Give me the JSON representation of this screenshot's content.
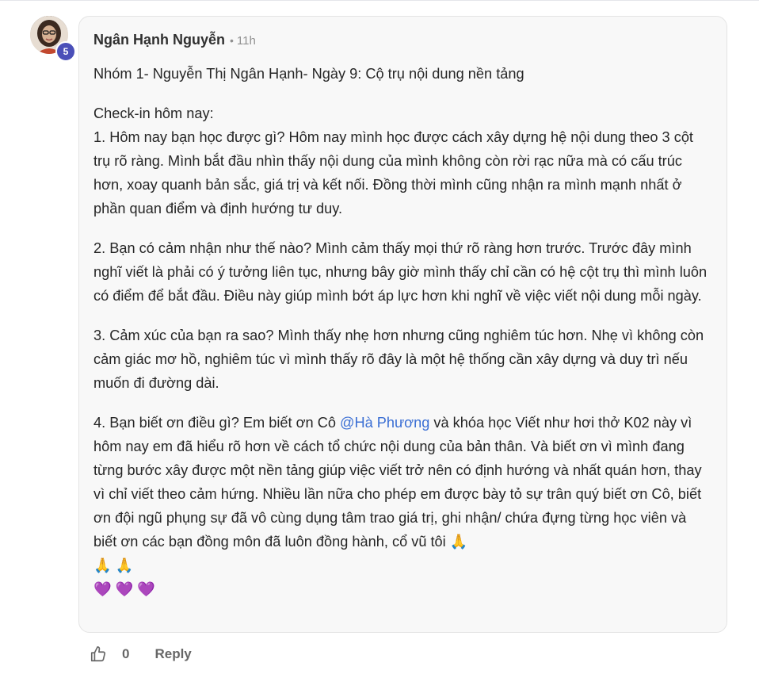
{
  "comment": {
    "author": "Ngân Hạnh Nguyễn",
    "separator": "•",
    "time": "11h",
    "level": "5",
    "title_line": "Nhóm 1- Nguyễn Thị Ngân Hạnh- Ngày 9: Cộ trụ nội dung nền tảng",
    "checkin_heading": "Check-in hôm nay:",
    "q1": "1. Hôm nay bạn học được gì? Hôm nay mình học được cách xây dựng hệ nội dung theo 3 cột trụ rõ ràng. Mình bắt đầu nhìn thấy nội dung của mình không còn rời rạc nữa mà có cấu trúc hơn, xoay quanh bản sắc, giá trị và kết nối. Đồng thời mình cũng nhận ra mình mạnh nhất ở phần quan điểm và định hướng tư duy.",
    "q2": "2. Bạn có cảm nhận như thế nào? Mình cảm thấy mọi thứ rõ ràng hơn trước. Trước đây mình nghĩ viết là phải có ý tưởng liên tục, nhưng bây giờ mình thấy chỉ cần có hệ cột trụ thì mình luôn có điểm để bắt đầu. Điều này giúp mình bớt áp lực hơn khi nghĩ về việc viết nội dung mỗi ngày.",
    "q3": "3. Cảm xúc của bạn ra sao? Mình thấy nhẹ hơn nhưng cũng nghiêm túc hơn. Nhẹ vì không còn cảm giác mơ hồ, nghiêm túc vì mình thấy rõ đây là một hệ thống cần xây dựng và duy trì nếu muốn đi đường dài.",
    "q4_before": "4. Bạn biết ơn điều gì? Em biết ơn Cô ",
    "q4_mention": "@Hà Phương",
    "q4_after": " và khóa học Viết như hơi thở K02 này vì hôm nay em đã hiểu rõ hơn về cách tổ chức nội dung của bản thân. Và biết ơn vì mình đang từng bước xây được một nền tảng giúp việc viết trở nên có định hướng và nhất quán hơn, thay vì chỉ viết theo cảm hứng. Nhiều lần nữa cho phép em được bày tỏ sự trân quý biết ơn Cô, biết ơn đội ngũ phụng sự đã vô cùng dụng tâm trao giá trị, ghi nhận/ chứa đựng từng học viên và biết ơn các bạn đồng môn đã luôn đồng hành, cổ vũ tôi ",
    "emoji_pray": "🙏",
    "emoji_hearts": "💜 💜 💜"
  },
  "actions": {
    "like_count": "0",
    "reply_label": "Reply"
  },
  "icons": {
    "like": "thumbs-up-icon",
    "avatar": "profile-photo"
  },
  "colors": {
    "bubble_bg": "#f8f8f8",
    "mention": "#3b6fd4",
    "badge": "#4a4fb8"
  }
}
